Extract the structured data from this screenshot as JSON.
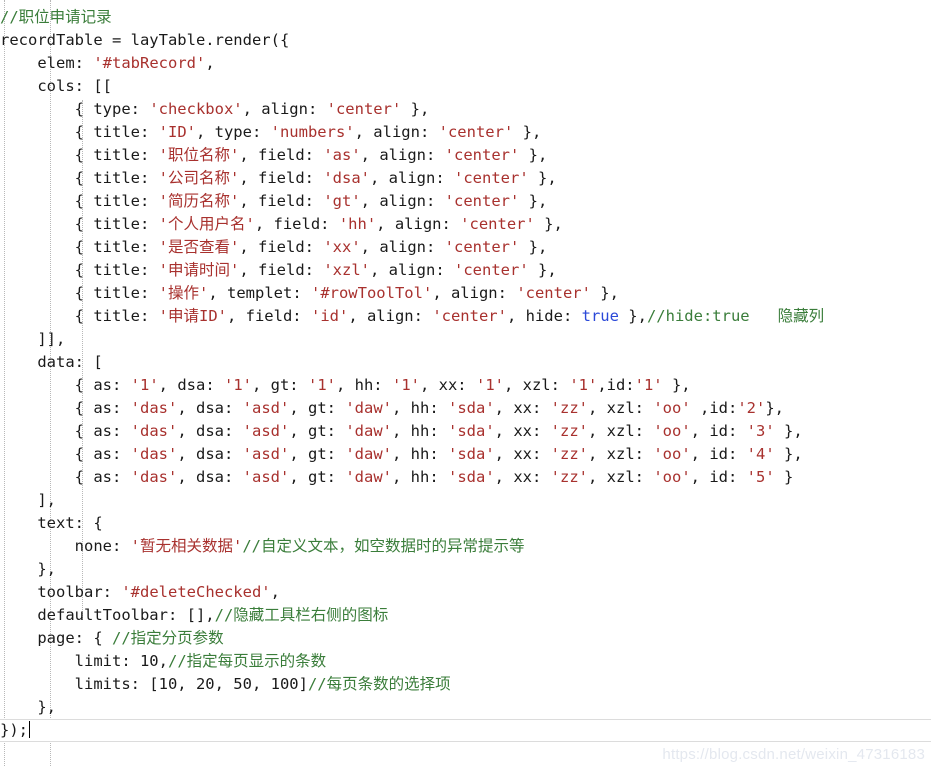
{
  "editor": {
    "language": "javascript",
    "colors": {
      "background": "#ffffff",
      "text": "#1a1a1a",
      "string": "#a8312e",
      "comment": "#3a7d3a",
      "keyword": "#2a48d8",
      "indent_guide": "#b8b8b8",
      "current_line_border": "#dcdcdc",
      "watermark": "#e4e8ef"
    },
    "watermark": "https://blog.csdn.net/weixin_47316183",
    "cursor_line_index": 33
  },
  "lines": [
    {
      "indent": 0,
      "tokens": [
        {
          "t": "cmt",
          "v": "//职位申请记录"
        }
      ]
    },
    {
      "indent": 0,
      "tokens": [
        {
          "t": "plain",
          "v": "recordTable = layTable.render({"
        }
      ]
    },
    {
      "indent": 1,
      "tokens": [
        {
          "t": "plain",
          "v": "elem: "
        },
        {
          "t": "str",
          "v": "'#tabRecord'"
        },
        {
          "t": "plain",
          "v": ","
        }
      ]
    },
    {
      "indent": 1,
      "tokens": [
        {
          "t": "plain",
          "v": "cols: [["
        }
      ]
    },
    {
      "indent": 2,
      "tokens": [
        {
          "t": "plain",
          "v": "{ type: "
        },
        {
          "t": "str",
          "v": "'checkbox'"
        },
        {
          "t": "plain",
          "v": ", align: "
        },
        {
          "t": "str",
          "v": "'center'"
        },
        {
          "t": "plain",
          "v": " },"
        }
      ]
    },
    {
      "indent": 2,
      "tokens": [
        {
          "t": "plain",
          "v": "{ title: "
        },
        {
          "t": "str",
          "v": "'ID'"
        },
        {
          "t": "plain",
          "v": ", type: "
        },
        {
          "t": "str",
          "v": "'numbers'"
        },
        {
          "t": "plain",
          "v": ", align: "
        },
        {
          "t": "str",
          "v": "'center'"
        },
        {
          "t": "plain",
          "v": " },"
        }
      ]
    },
    {
      "indent": 2,
      "tokens": [
        {
          "t": "plain",
          "v": "{ title: "
        },
        {
          "t": "str",
          "v": "'职位名称'"
        },
        {
          "t": "plain",
          "v": ", field: "
        },
        {
          "t": "str",
          "v": "'as'"
        },
        {
          "t": "plain",
          "v": ", align: "
        },
        {
          "t": "str",
          "v": "'center'"
        },
        {
          "t": "plain",
          "v": " },"
        }
      ]
    },
    {
      "indent": 2,
      "tokens": [
        {
          "t": "plain",
          "v": "{ title: "
        },
        {
          "t": "str",
          "v": "'公司名称'"
        },
        {
          "t": "plain",
          "v": ", field: "
        },
        {
          "t": "str",
          "v": "'dsa'"
        },
        {
          "t": "plain",
          "v": ", align: "
        },
        {
          "t": "str",
          "v": "'center'"
        },
        {
          "t": "plain",
          "v": " },"
        }
      ]
    },
    {
      "indent": 2,
      "tokens": [
        {
          "t": "plain",
          "v": "{ title: "
        },
        {
          "t": "str",
          "v": "'简历名称'"
        },
        {
          "t": "plain",
          "v": ", field: "
        },
        {
          "t": "str",
          "v": "'gt'"
        },
        {
          "t": "plain",
          "v": ", align: "
        },
        {
          "t": "str",
          "v": "'center'"
        },
        {
          "t": "plain",
          "v": " },"
        }
      ]
    },
    {
      "indent": 2,
      "tokens": [
        {
          "t": "plain",
          "v": "{ title: "
        },
        {
          "t": "str",
          "v": "'个人用户名'"
        },
        {
          "t": "plain",
          "v": ", field: "
        },
        {
          "t": "str",
          "v": "'hh'"
        },
        {
          "t": "plain",
          "v": ", align: "
        },
        {
          "t": "str",
          "v": "'center'"
        },
        {
          "t": "plain",
          "v": " },"
        }
      ]
    },
    {
      "indent": 2,
      "tokens": [
        {
          "t": "plain",
          "v": "{ title: "
        },
        {
          "t": "str",
          "v": "'是否查看'"
        },
        {
          "t": "plain",
          "v": ", field: "
        },
        {
          "t": "str",
          "v": "'xx'"
        },
        {
          "t": "plain",
          "v": ", align: "
        },
        {
          "t": "str",
          "v": "'center'"
        },
        {
          "t": "plain",
          "v": " },"
        }
      ]
    },
    {
      "indent": 2,
      "tokens": [
        {
          "t": "plain",
          "v": "{ title: "
        },
        {
          "t": "str",
          "v": "'申请时间'"
        },
        {
          "t": "plain",
          "v": ", field: "
        },
        {
          "t": "str",
          "v": "'xzl'"
        },
        {
          "t": "plain",
          "v": ", align: "
        },
        {
          "t": "str",
          "v": "'center'"
        },
        {
          "t": "plain",
          "v": " },"
        }
      ]
    },
    {
      "indent": 2,
      "tokens": [
        {
          "t": "plain",
          "v": "{ title: "
        },
        {
          "t": "str",
          "v": "'操作'"
        },
        {
          "t": "plain",
          "v": ", templet: "
        },
        {
          "t": "str",
          "v": "'#rowToolTol'"
        },
        {
          "t": "plain",
          "v": ", align: "
        },
        {
          "t": "str",
          "v": "'center'"
        },
        {
          "t": "plain",
          "v": " },"
        }
      ]
    },
    {
      "indent": 2,
      "tokens": [
        {
          "t": "plain",
          "v": "{ title: "
        },
        {
          "t": "str",
          "v": "'申请ID'"
        },
        {
          "t": "plain",
          "v": ", field: "
        },
        {
          "t": "str",
          "v": "'id'"
        },
        {
          "t": "plain",
          "v": ", align: "
        },
        {
          "t": "str",
          "v": "'center'"
        },
        {
          "t": "plain",
          "v": ", hide: "
        },
        {
          "t": "kw",
          "v": "true"
        },
        {
          "t": "plain",
          "v": " },"
        },
        {
          "t": "cmt",
          "v": "//hide:true   隐藏列"
        }
      ]
    },
    {
      "indent": 1,
      "tokens": [
        {
          "t": "plain",
          "v": "]],"
        }
      ]
    },
    {
      "indent": 1,
      "tokens": [
        {
          "t": "plain",
          "v": "data: ["
        }
      ]
    },
    {
      "indent": 2,
      "tokens": [
        {
          "t": "plain",
          "v": "{ as: "
        },
        {
          "t": "str",
          "v": "'1'"
        },
        {
          "t": "plain",
          "v": ", dsa: "
        },
        {
          "t": "str",
          "v": "'1'"
        },
        {
          "t": "plain",
          "v": ", gt: "
        },
        {
          "t": "str",
          "v": "'1'"
        },
        {
          "t": "plain",
          "v": ", hh: "
        },
        {
          "t": "str",
          "v": "'1'"
        },
        {
          "t": "plain",
          "v": ", xx: "
        },
        {
          "t": "str",
          "v": "'1'"
        },
        {
          "t": "plain",
          "v": ", xzl: "
        },
        {
          "t": "str",
          "v": "'1'"
        },
        {
          "t": "plain",
          "v": ",id:"
        },
        {
          "t": "str",
          "v": "'1'"
        },
        {
          "t": "plain",
          "v": " },"
        }
      ]
    },
    {
      "indent": 2,
      "tokens": [
        {
          "t": "plain",
          "v": "{ as: "
        },
        {
          "t": "str",
          "v": "'das'"
        },
        {
          "t": "plain",
          "v": ", dsa: "
        },
        {
          "t": "str",
          "v": "'asd'"
        },
        {
          "t": "plain",
          "v": ", gt: "
        },
        {
          "t": "str",
          "v": "'daw'"
        },
        {
          "t": "plain",
          "v": ", hh: "
        },
        {
          "t": "str",
          "v": "'sda'"
        },
        {
          "t": "plain",
          "v": ", xx: "
        },
        {
          "t": "str",
          "v": "'zz'"
        },
        {
          "t": "plain",
          "v": ", xzl: "
        },
        {
          "t": "str",
          "v": "'oo'"
        },
        {
          "t": "plain",
          "v": " ,id:"
        },
        {
          "t": "str",
          "v": "'2'"
        },
        {
          "t": "plain",
          "v": "},"
        }
      ]
    },
    {
      "indent": 2,
      "tokens": [
        {
          "t": "plain",
          "v": "{ as: "
        },
        {
          "t": "str",
          "v": "'das'"
        },
        {
          "t": "plain",
          "v": ", dsa: "
        },
        {
          "t": "str",
          "v": "'asd'"
        },
        {
          "t": "plain",
          "v": ", gt: "
        },
        {
          "t": "str",
          "v": "'daw'"
        },
        {
          "t": "plain",
          "v": ", hh: "
        },
        {
          "t": "str",
          "v": "'sda'"
        },
        {
          "t": "plain",
          "v": ", xx: "
        },
        {
          "t": "str",
          "v": "'zz'"
        },
        {
          "t": "plain",
          "v": ", xzl: "
        },
        {
          "t": "str",
          "v": "'oo'"
        },
        {
          "t": "plain",
          "v": ", id: "
        },
        {
          "t": "str",
          "v": "'3'"
        },
        {
          "t": "plain",
          "v": " },"
        }
      ]
    },
    {
      "indent": 2,
      "tokens": [
        {
          "t": "plain",
          "v": "{ as: "
        },
        {
          "t": "str",
          "v": "'das'"
        },
        {
          "t": "plain",
          "v": ", dsa: "
        },
        {
          "t": "str",
          "v": "'asd'"
        },
        {
          "t": "plain",
          "v": ", gt: "
        },
        {
          "t": "str",
          "v": "'daw'"
        },
        {
          "t": "plain",
          "v": ", hh: "
        },
        {
          "t": "str",
          "v": "'sda'"
        },
        {
          "t": "plain",
          "v": ", xx: "
        },
        {
          "t": "str",
          "v": "'zz'"
        },
        {
          "t": "plain",
          "v": ", xzl: "
        },
        {
          "t": "str",
          "v": "'oo'"
        },
        {
          "t": "plain",
          "v": ", id: "
        },
        {
          "t": "str",
          "v": "'4'"
        },
        {
          "t": "plain",
          "v": " },"
        }
      ]
    },
    {
      "indent": 2,
      "tokens": [
        {
          "t": "plain",
          "v": "{ as: "
        },
        {
          "t": "str",
          "v": "'das'"
        },
        {
          "t": "plain",
          "v": ", dsa: "
        },
        {
          "t": "str",
          "v": "'asd'"
        },
        {
          "t": "plain",
          "v": ", gt: "
        },
        {
          "t": "str",
          "v": "'daw'"
        },
        {
          "t": "plain",
          "v": ", hh: "
        },
        {
          "t": "str",
          "v": "'sda'"
        },
        {
          "t": "plain",
          "v": ", xx: "
        },
        {
          "t": "str",
          "v": "'zz'"
        },
        {
          "t": "plain",
          "v": ", xzl: "
        },
        {
          "t": "str",
          "v": "'oo'"
        },
        {
          "t": "plain",
          "v": ", id: "
        },
        {
          "t": "str",
          "v": "'5'"
        },
        {
          "t": "plain",
          "v": " }"
        }
      ]
    },
    {
      "indent": 1,
      "tokens": [
        {
          "t": "plain",
          "v": "],"
        }
      ]
    },
    {
      "indent": 1,
      "tokens": [
        {
          "t": "plain",
          "v": "text: {"
        }
      ]
    },
    {
      "indent": 2,
      "tokens": [
        {
          "t": "plain",
          "v": "none: "
        },
        {
          "t": "str",
          "v": "'暂无相关数据'"
        },
        {
          "t": "cmt",
          "v": "//自定义文本，如空数据时的异常提示等"
        }
      ]
    },
    {
      "indent": 1,
      "tokens": [
        {
          "t": "plain",
          "v": "},"
        }
      ]
    },
    {
      "indent": 1,
      "tokens": [
        {
          "t": "plain",
          "v": "toolbar: "
        },
        {
          "t": "str",
          "v": "'#deleteChecked'"
        },
        {
          "t": "plain",
          "v": ","
        }
      ]
    },
    {
      "indent": 1,
      "tokens": [
        {
          "t": "plain",
          "v": "defaultToolbar: [],"
        },
        {
          "t": "cmt",
          "v": "//隐藏工具栏右侧的图标"
        }
      ]
    },
    {
      "indent": 1,
      "tokens": [
        {
          "t": "plain",
          "v": "page: { "
        },
        {
          "t": "cmt",
          "v": "//指定分页参数"
        }
      ]
    },
    {
      "indent": 2,
      "tokens": [
        {
          "t": "plain",
          "v": "limit: 10,"
        },
        {
          "t": "cmt",
          "v": "//指定每页显示的条数"
        }
      ]
    },
    {
      "indent": 2,
      "tokens": [
        {
          "t": "plain",
          "v": "limits: [10, 20, 50, 100]"
        },
        {
          "t": "cmt",
          "v": "//每页条数的选择项"
        }
      ]
    },
    {
      "indent": 1,
      "tokens": [
        {
          "t": "plain",
          "v": "},"
        }
      ]
    },
    {
      "indent": 0,
      "tokens": [
        {
          "t": "plain",
          "v": "});"
        }
      ],
      "current": true
    }
  ],
  "indent_guides": [
    {
      "x": 4
    },
    {
      "x": 50
    },
    {
      "x": 82
    }
  ]
}
